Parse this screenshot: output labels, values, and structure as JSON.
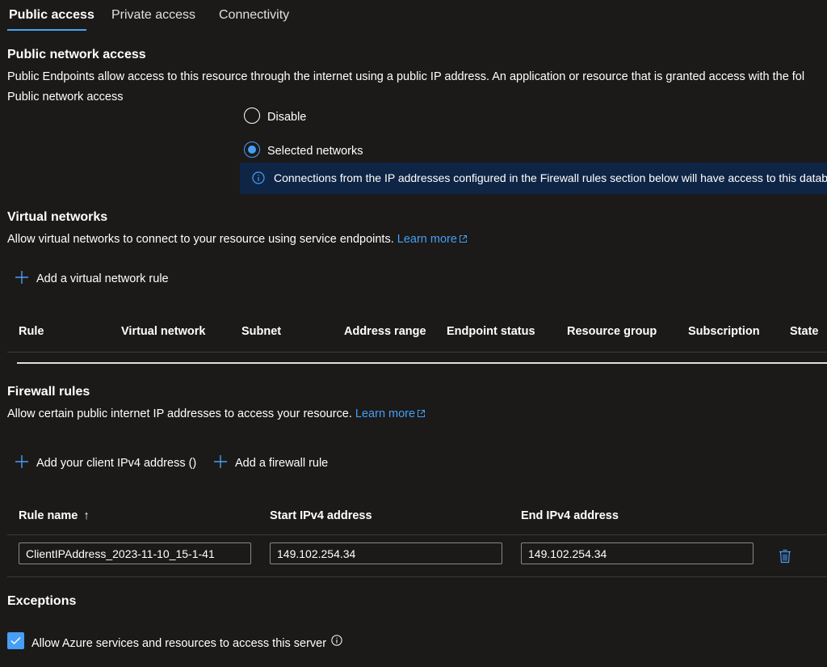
{
  "tabs": [
    {
      "label": "Public access",
      "active": true
    },
    {
      "label": "Private access",
      "active": false
    },
    {
      "label": "Connectivity",
      "active": false
    }
  ],
  "public_network": {
    "title": "Public network access",
    "description": "Public Endpoints allow access to this resource through the internet using a public IP address. An application or resource that is granted access with the fol",
    "field_label": "Public network access",
    "options": [
      {
        "label": "Disable",
        "selected": false
      },
      {
        "label": "Selected networks",
        "selected": true
      }
    ],
    "info_text": "Connections from the IP addresses configured in the Firewall rules section below will have access to this database"
  },
  "virtual_networks": {
    "title": "Virtual networks",
    "description": "Allow virtual networks to connect to your resource using service endpoints.",
    "learn_more": "Learn more",
    "add_rule": "Add a virtual network rule",
    "columns": [
      "Rule",
      "Virtual network",
      "Subnet",
      "Address range",
      "Endpoint status",
      "Resource group",
      "Subscription",
      "State"
    ]
  },
  "firewall": {
    "title": "Firewall rules",
    "description": "Allow certain public internet IP addresses to access your resource.",
    "learn_more": "Learn more",
    "add_client": "Add your client IPv4 address ()",
    "add_rule": "Add a firewall rule",
    "columns": {
      "rule_name": "Rule name",
      "sort_arrow": "↑",
      "start": "Start IPv4 address",
      "end": "End IPv4 address"
    },
    "rows": [
      {
        "rule_name": "ClientIPAddress_2023-11-10_15-1-41",
        "start": "149.102.254.34",
        "end": "149.102.254.34"
      }
    ]
  },
  "exceptions": {
    "title": "Exceptions",
    "allow_azure_label": "Allow Azure services and resources to access this server",
    "allow_azure_checked": true
  },
  "colors": {
    "accent": "#479ef5",
    "background": "#1b1a19",
    "info_bar": "#0f2545"
  }
}
